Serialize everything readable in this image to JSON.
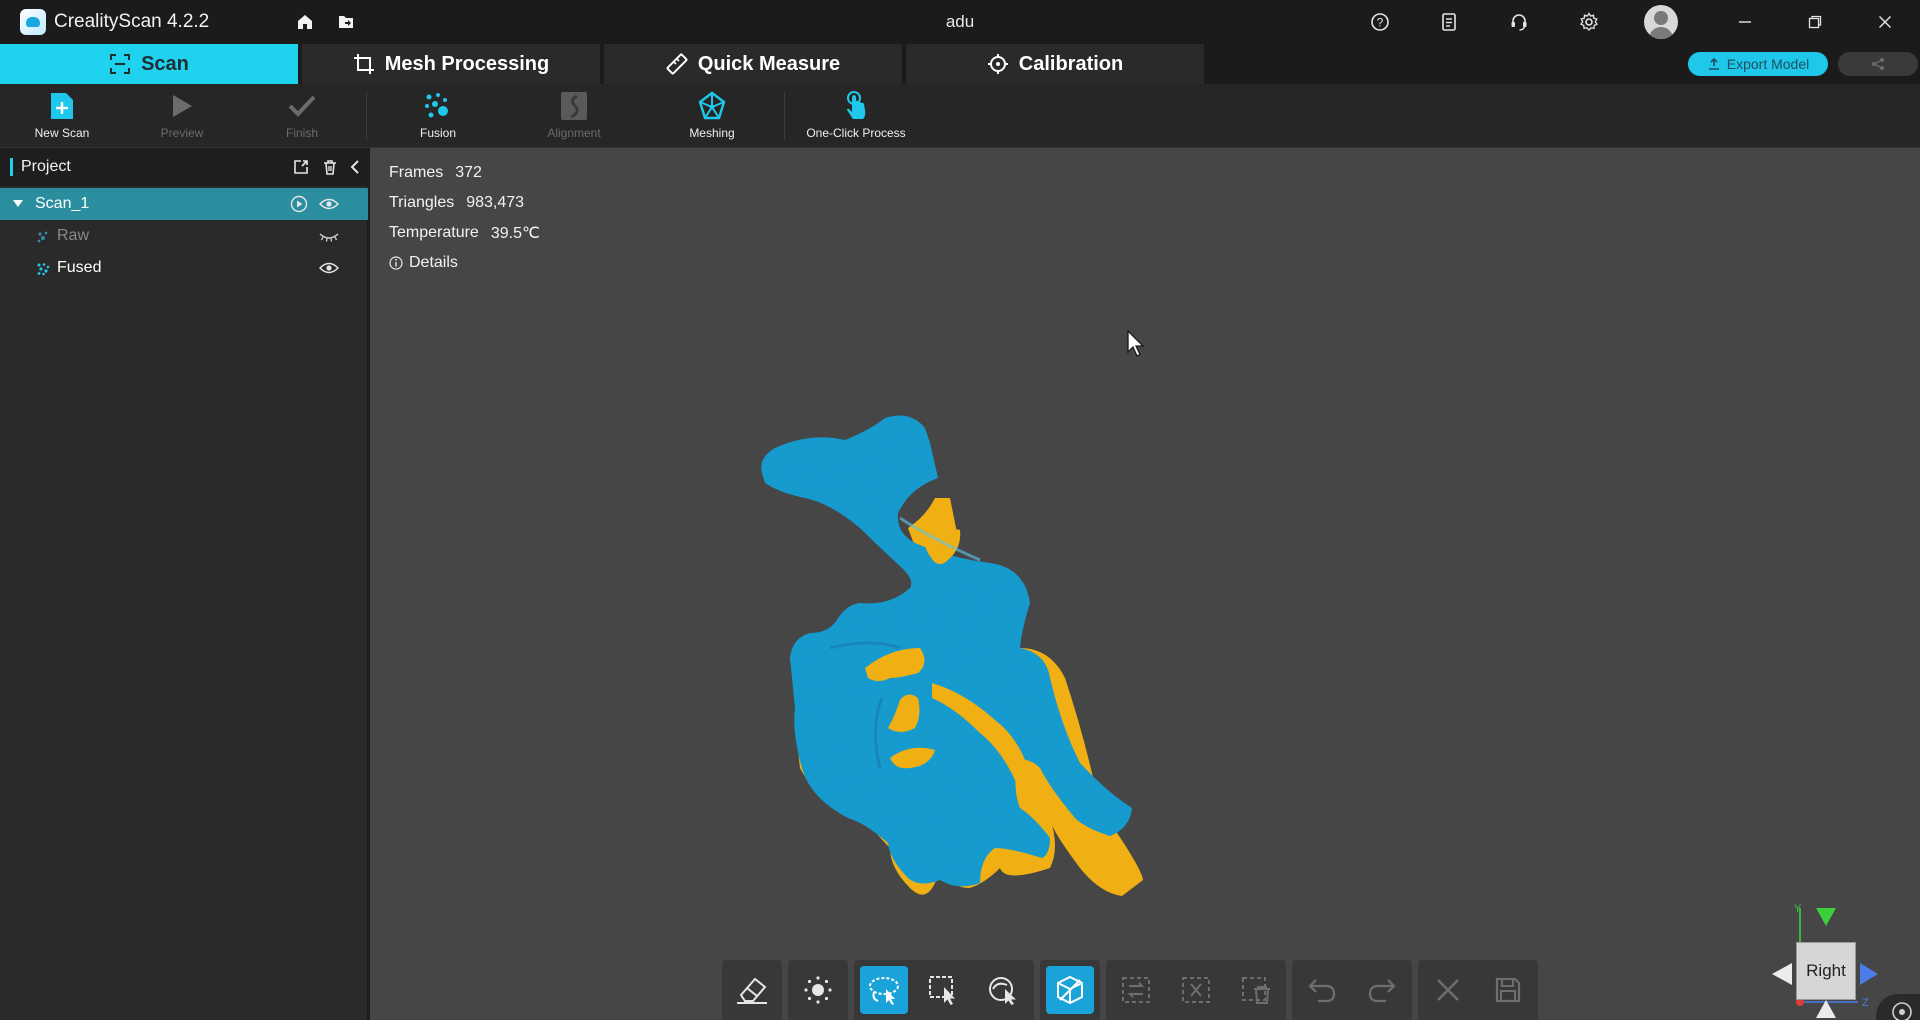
{
  "window": {
    "app_title": "CrealityScan 4.2.2",
    "document_title": "adu"
  },
  "tabs": [
    {
      "label": "Scan",
      "active": true
    },
    {
      "label": "Mesh Processing",
      "active": false
    },
    {
      "label": "Quick Measure",
      "active": false
    },
    {
      "label": "Calibration",
      "active": false
    }
  ],
  "actions": {
    "export_label": "Export Model"
  },
  "toolbar": {
    "new_scan": "New Scan",
    "preview": "Preview",
    "finish": "Finish",
    "fusion": "Fusion",
    "alignment": "Alignment",
    "meshing": "Meshing",
    "one_click": "One-Click Process"
  },
  "project": {
    "title": "Project",
    "items": [
      {
        "label": "Scan_1",
        "selected": true
      },
      {
        "label": "Raw",
        "visible": false
      },
      {
        "label": "Fused",
        "visible": true
      }
    ]
  },
  "stats": {
    "frames_label": "Frames",
    "frames_value": "372",
    "triangles_label": "Triangles",
    "triangles_value": "983,473",
    "temperature_label": "Temperature",
    "temperature_value": "39.5℃",
    "details_label": "Details"
  },
  "view_cube": {
    "face_label": "Right"
  },
  "colors": {
    "accent": "#1fd2ee",
    "selected_row": "#2b8e9e",
    "model_surface": "#1ea0d6",
    "model_edge": "#f0b014",
    "viewport_bg": "#464646"
  }
}
